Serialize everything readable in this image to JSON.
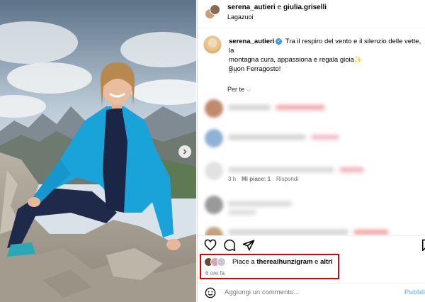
{
  "post": {
    "image_alt": "Woman in blue jacket sitting on a rock on a mountain summit",
    "carousel_next_icon": "chevron-right-icon"
  },
  "header": {
    "user1": "serena_autieri",
    "and_word": "e",
    "user2": "giulia.griselli",
    "location": "Lagazuoi"
  },
  "caption": {
    "username": "serena_autieri",
    "line1": "Tra il respiro del vento e il silenzio delle vette, la",
    "line2": "montagna cura, appassiona e regala gioia✨",
    "line3": "Buon Ferragosto!",
    "time": "6 h"
  },
  "comments_filter": {
    "label": "Per te"
  },
  "comments": [
    {
      "blurred": true
    },
    {
      "blurred": true
    },
    {
      "blurred": true,
      "time": "3 h",
      "likes": "Mi piace: 1",
      "reply": "Rispondi"
    },
    {
      "blurred": true
    },
    {
      "blurred": true
    }
  ],
  "likes": {
    "prefix": "Piace a",
    "user": "therealhunzigram",
    "and_word": "e",
    "others": "altri",
    "time": "6 ore fa"
  },
  "add_comment": {
    "placeholder": "Aggiungi un commento...",
    "publish_label": "Pubblica"
  },
  "colors": {
    "highlight_border": "#e00000",
    "verified": "#3897f0",
    "publish": "#8fbff5"
  }
}
